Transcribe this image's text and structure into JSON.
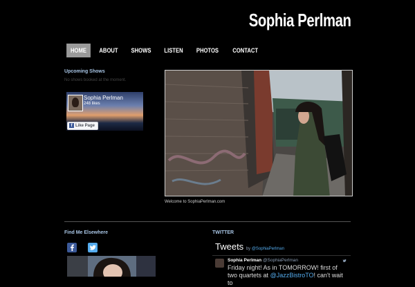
{
  "site": {
    "title": "Sophia Perlman"
  },
  "nav": {
    "items": [
      {
        "label": "HOME"
      },
      {
        "label": "ABOUT"
      },
      {
        "label": "SHOWS"
      },
      {
        "label": "LISTEN"
      },
      {
        "label": "PHOTOS"
      },
      {
        "label": "CONTACT"
      }
    ],
    "active_index": 0
  },
  "shows": {
    "heading": "Upcoming Shows",
    "empty_text": "No shows booked at the moment."
  },
  "facebook_widget": {
    "name": "Sophia Perlman",
    "likes": "248 likes",
    "like_button": "Like Page"
  },
  "hero": {
    "caption": "Welcome to SophiaPerlman.com"
  },
  "find_elsewhere": {
    "heading": "Find Me Elsewhere"
  },
  "twitter": {
    "heading": "TWITTER",
    "widget_title": "Tweets",
    "by_label": "by",
    "by_handle": "@SophiaPerlman",
    "tweet": {
      "author": "Sophia Perlman",
      "handle": "@SophiaPerlman",
      "text_start": "Friday night! As in TOMORROW! first of two quartets at",
      "mention": "@JazzBistroTO",
      "text_end": "! can't wait to"
    }
  },
  "colors": {
    "background": "#000000",
    "heading_blue": "#a9c6e6",
    "nav_active": "#9a9a9a",
    "facebook": "#3b5998",
    "twitter": "#55acee"
  }
}
